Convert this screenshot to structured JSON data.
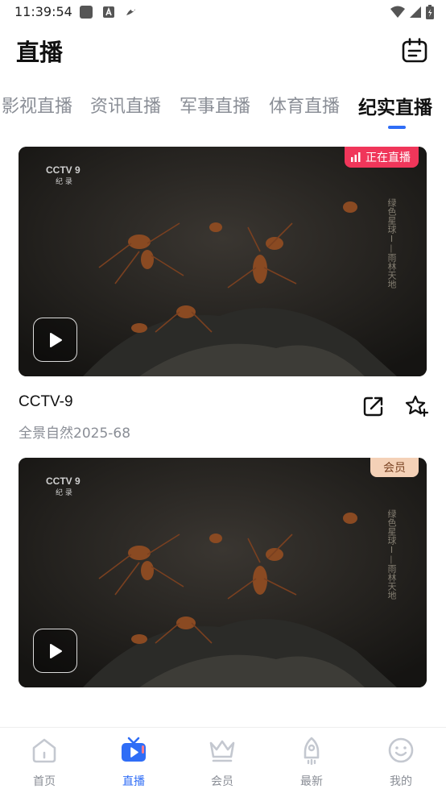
{
  "status_bar": {
    "time": "11:39:54"
  },
  "header": {
    "title": "直播"
  },
  "tabs": [
    {
      "label": "影视直播"
    },
    {
      "label": "资讯直播"
    },
    {
      "label": "军事直播"
    },
    {
      "label": "体育直播"
    },
    {
      "label": "纪实直播"
    }
  ],
  "active_tab": "纪实直播",
  "cards": [
    {
      "channel": "CCTV-9",
      "program": "全景自然2025-68",
      "badge": "正在直播",
      "badge_color": "#f0365a",
      "logo_text": "CCTV 9",
      "logo_sub": "纪 录",
      "overlay_text": "绿色星球Ⅰ—雨林天地"
    },
    {
      "badge": "会员",
      "badge_color": "#f4d1b7",
      "logo_text": "CCTV 9",
      "logo_sub": "纪 录",
      "overlay_text": "绿色星球Ⅰ—雨林天地"
    }
  ],
  "bottom_nav": [
    {
      "label": "首页",
      "icon": "home-icon"
    },
    {
      "label": "直播",
      "icon": "tv-icon"
    },
    {
      "label": "会员",
      "icon": "crown-icon"
    },
    {
      "label": "最新",
      "icon": "rocket-icon"
    },
    {
      "label": "我的",
      "icon": "smile-icon"
    }
  ],
  "colors": {
    "accent": "#2f6df6",
    "live_badge": "#f0365a",
    "vip_badge": "#f4d1b7"
  }
}
